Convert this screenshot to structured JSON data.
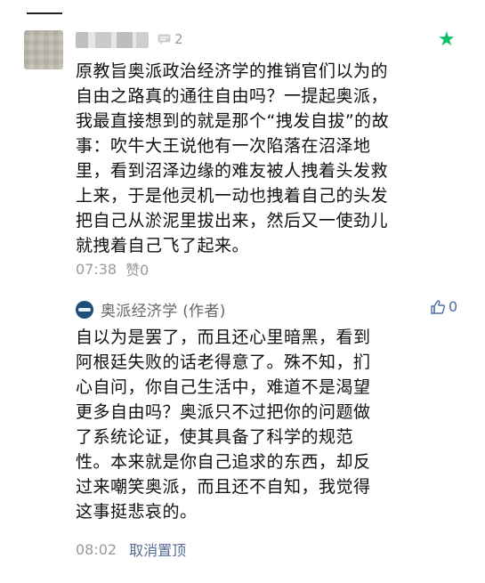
{
  "comment": {
    "avatar": "blurred-avatar",
    "reply_count": "2",
    "starred_icon": "star-icon",
    "text": "原教旨奥派政治经济学的推销官们以为的\n自由之路真的通往自由吗？一提起奥派，\n我最直接想到的就是那个“拽发自拔”的故\n事：吹牛大王说他有一次陷落在沼泽地\n里，看到沼泽边缘的难友被人拽着头发救\n上来，于是他灵机一动也拽着自己的头发\n把自己从淤泥里拔出来，然后又一使劲儿\n就拽着自己飞了起来。",
    "time": "07:38",
    "likes": "赞0"
  },
  "reply": {
    "author": "奥派经济学 (作者)",
    "likes_count": "0",
    "text": "自以为是罢了，而且还心里暗黑，看到\n阿根廷失败的话老得意了。殊不知，扪\n心自问，你自己生活中，难道不是渴望\n更多自由吗？奥派只不过把你的问题做\n了系统论证，使其具备了科学的规范\n性。本来就是你自己追求的东西，却反\n过来嘲笑奥派，而且还不自知，我觉得\n这事挺悲哀的。",
    "time": "08:02",
    "unpin_label": "取消置顶"
  },
  "colors": {
    "accent_green": "#07c160",
    "link_blue": "#576b95",
    "meta_gray": "#9a9a9a"
  }
}
